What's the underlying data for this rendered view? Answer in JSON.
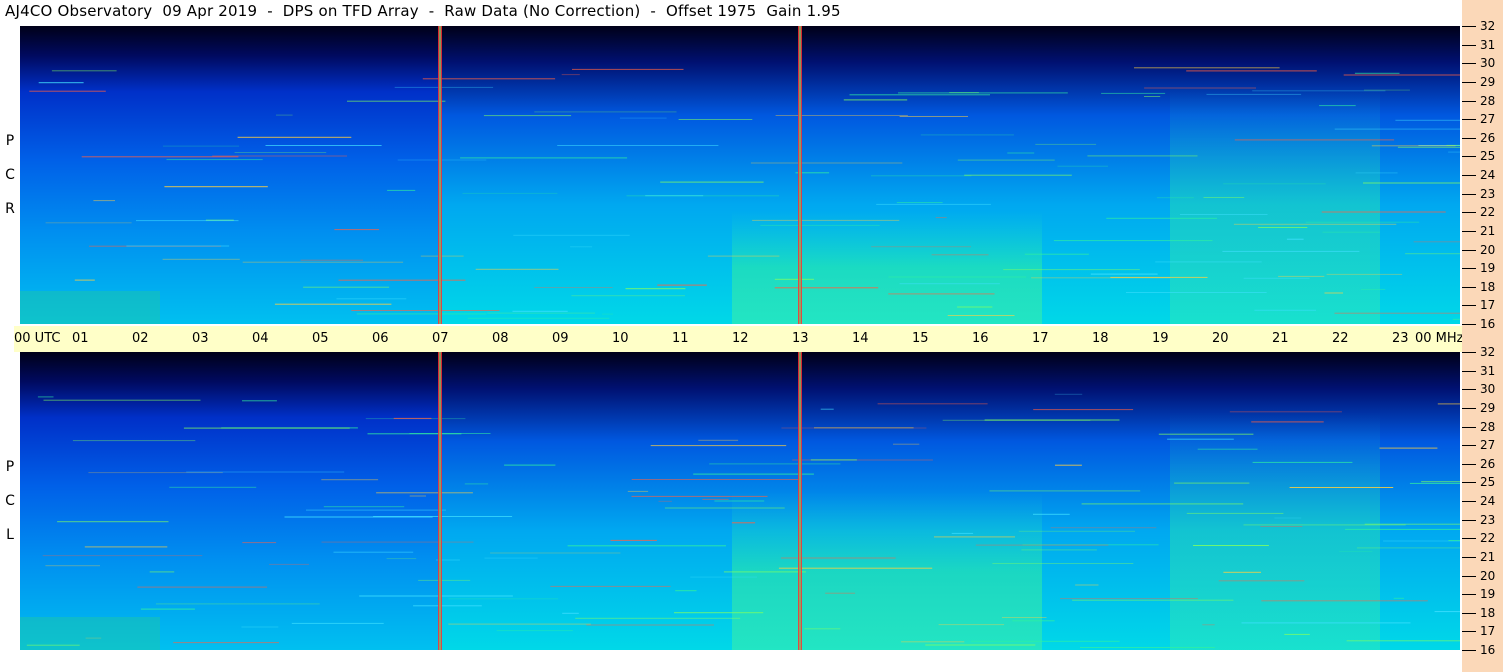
{
  "title": "AJ4CO Observatory  09 Apr 2019  -  DPS on TFD Array  -  Raw Data (No Correction)  -  Offset 1975  Gain 1.95",
  "panels": [
    {
      "id": "rcp",
      "label_letters": [
        "R",
        "C",
        "P"
      ]
    },
    {
      "id": "lcp",
      "label_letters": [
        "L",
        "C",
        "P"
      ]
    }
  ],
  "time_axis": {
    "hours": [
      "00",
      "01",
      "02",
      "03",
      "04",
      "05",
      "06",
      "07",
      "08",
      "09",
      "10",
      "11",
      "12",
      "13",
      "14",
      "15",
      "16",
      "17",
      "18",
      "19",
      "20",
      "21",
      "22",
      "23",
      "00"
    ],
    "start_unit": "UTC",
    "end_unit": "MHz"
  },
  "freq_axis": {
    "labels": [
      "32",
      "31",
      "30",
      "29",
      "28",
      "27",
      "26",
      "25",
      "24",
      "23",
      "22",
      "21",
      "20",
      "19",
      "18",
      "17",
      "16"
    ]
  },
  "colors": {
    "time_bar": "#ffffc8",
    "freq_bar": "#fbd8b8",
    "spectrogram_dark": "#00002a",
    "spectrogram_mid": "#0048d8",
    "spectrogram_low": "#00b4f0",
    "marker_line": "#ff3030"
  },
  "markers_utc": [
    "07",
    "13"
  ]
}
